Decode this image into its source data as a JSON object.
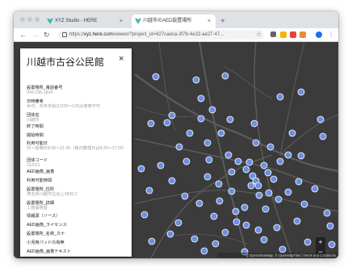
{
  "browser": {
    "tabs": [
      {
        "title": "XYZ Studio - HERE",
        "active": false
      },
      {
        "title": "川越市のAED設置場所",
        "active": true
      }
    ],
    "url_prefix": "https://",
    "url_host": "xyz.here.com",
    "url_path": "/viewer/?project_id=927caeca-3f7b-4e32-ae27-47...",
    "icons": {
      "back": "←",
      "forward": "→",
      "reload": "↻",
      "new_tab": "+",
      "close_tab": "×",
      "star": "☆",
      "menu": "⋮"
    }
  },
  "panel": {
    "title": "川越市古谷公民館",
    "close": "×",
    "fields": [
      {
        "label": "設置場所_電話番号",
        "value": "049-235-1834"
      },
      {
        "label": "日時備考",
        "value": "休日、年末年始(12/29〜1/3)は使用不可"
      },
      {
        "label": "団体名",
        "value": "川越市"
      },
      {
        "label": "終了時間",
        "value": ""
      },
      {
        "label": "開始時間",
        "value": ""
      },
      {
        "label": "利用可能日",
        "value": "月〜金曜日8:30〜21:30（館内整理日は8:30〜17:00）"
      },
      {
        "label": "団体コード",
        "value": "112011"
      },
      {
        "label": "AED画像_画像",
        "value": ""
      },
      {
        "label": "利用可能時間",
        "value": ""
      },
      {
        "label": "設置場所_住所",
        "value": "埼玉県川越市古谷上3830-2"
      },
      {
        "label": "設置場所_詳細",
        "value": "１階事務室"
      },
      {
        "label": "情報源（ソース）",
        "value": ""
      },
      {
        "label": "AED画像_ライセンス",
        "value": ""
      },
      {
        "label": "設置場所_名称_カナ",
        "value": ""
      },
      {
        "label": "小児用パッドの有無",
        "value": ""
      },
      {
        "label": "AED画像_画像テキスト",
        "value": ""
      }
    ]
  },
  "map": {
    "zoom_in": "+",
    "zoom_out": "−",
    "attribution": "© OpenStreetMap, © OpenMapTiles | Terms and Conditions",
    "marker_color": "#6b8fe0"
  }
}
